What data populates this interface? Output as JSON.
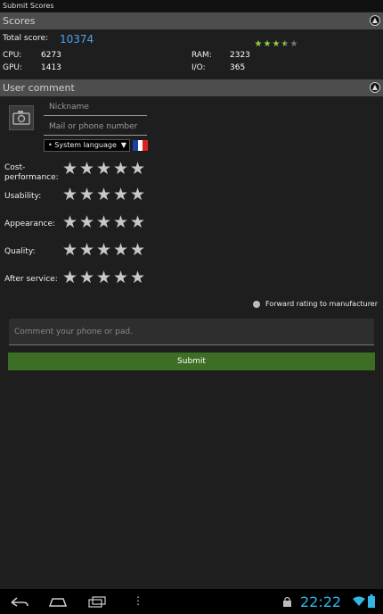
{
  "window": {
    "title": "Submit Scores"
  },
  "scores_section": {
    "title": "Scores",
    "total_label": "Total score:",
    "total_value": "10374",
    "rating": {
      "filled": 3.5,
      "max": 5,
      "filled_color": "#8fd13c",
      "empty_color": "#777777"
    },
    "cpu_label": "CPU:",
    "cpu_value": "6273",
    "gpu_label": "GPU:",
    "gpu_value": "1413",
    "ram_label": "RAM:",
    "ram_value": "2323",
    "io_label": "I/O:",
    "io_value": "365"
  },
  "comment_section": {
    "title": "User comment",
    "nickname_placeholder": "Nickname",
    "contact_placeholder": "Mail or phone number",
    "language_select": "• System language",
    "criteria": [
      {
        "label": "Cost-\nperformance:"
      },
      {
        "label": "Usability:"
      },
      {
        "label": "Appearance:"
      },
      {
        "label": "Quality:"
      },
      {
        "label": "After service:"
      }
    ],
    "forward_label": "Forward rating to manufacturer",
    "comment_placeholder": "Comment your phone or pad.",
    "submit_label": "Submit"
  },
  "status_bar": {
    "time": "22:22"
  },
  "icons": [
    "camera-icon",
    "back-icon",
    "home-icon",
    "recent-apps-icon",
    "menu-icon",
    "lock-icon",
    "wifi-icon",
    "battery-icon"
  ],
  "colors": {
    "accent": "#4aa3f0",
    "submit_bg": "#3c6e24",
    "clock": "#33b5e5"
  }
}
